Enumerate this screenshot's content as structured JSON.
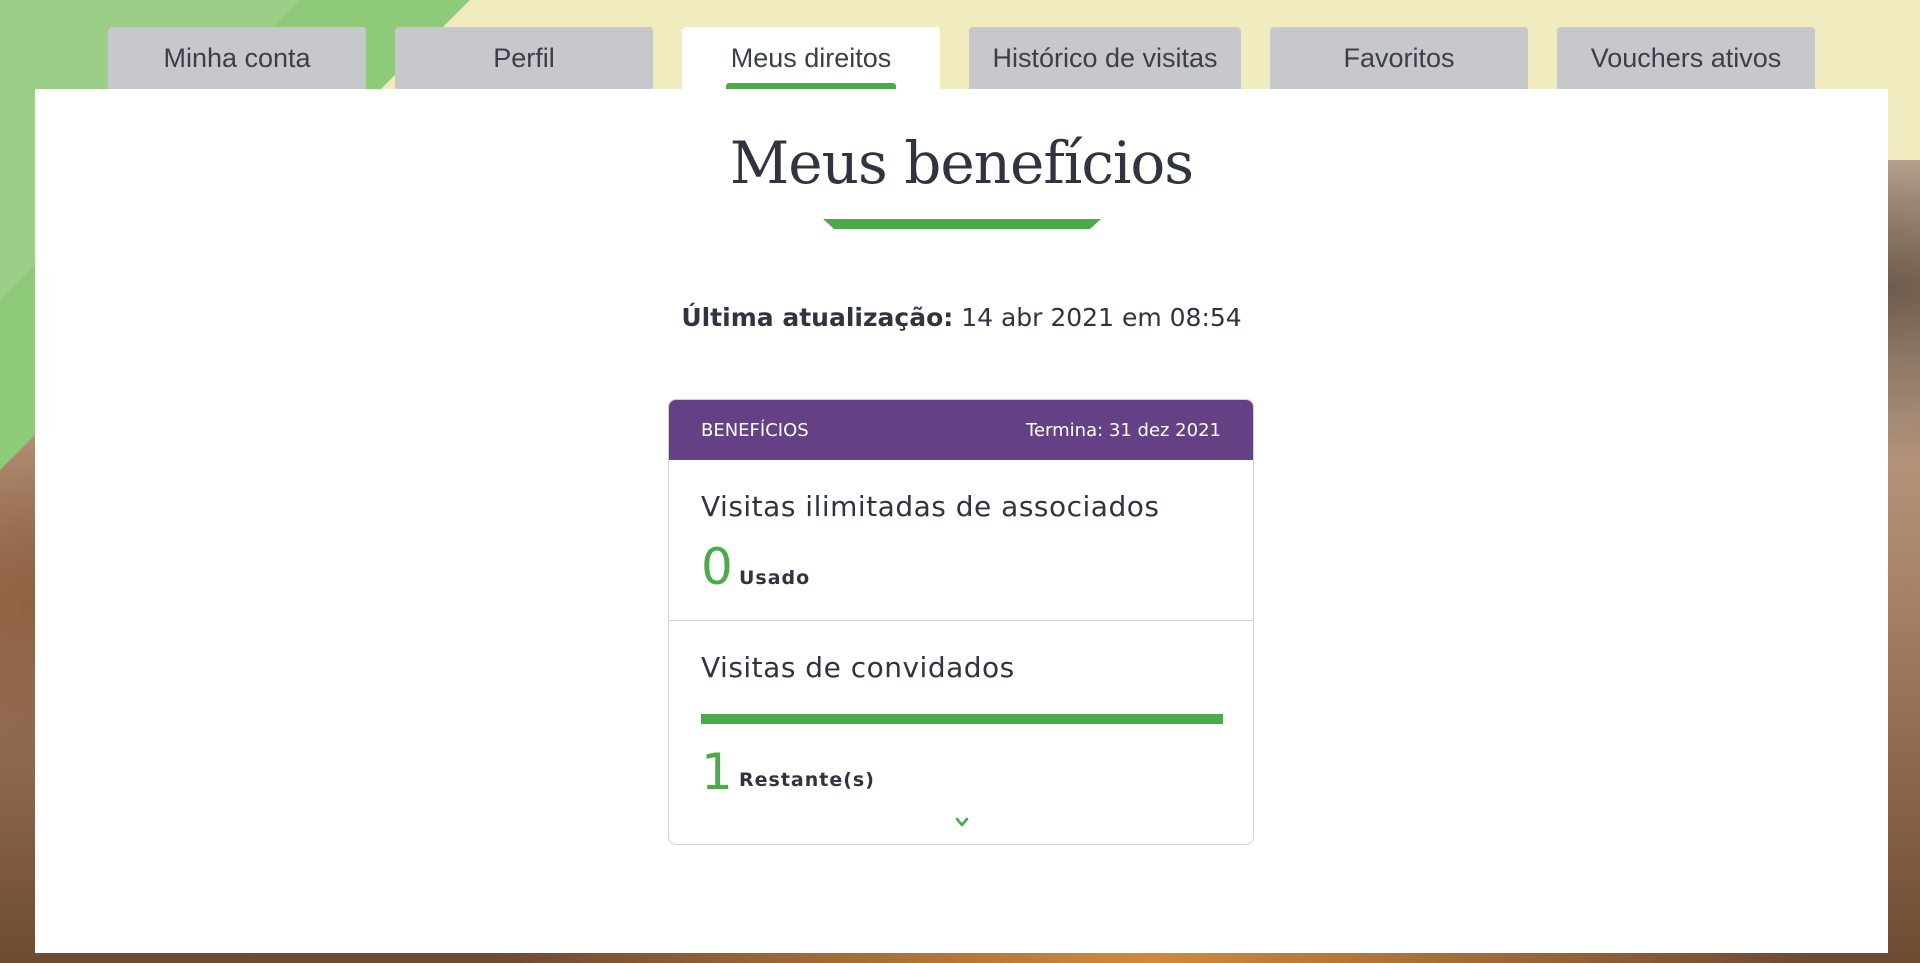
{
  "tabs": [
    {
      "label": "Minha conta"
    },
    {
      "label": "Perfil"
    },
    {
      "label": "Meus direitos",
      "active": true
    },
    {
      "label": "Histórico de visitas"
    },
    {
      "label": "Favoritos"
    },
    {
      "label": "Vouchers ativos"
    }
  ],
  "main": {
    "title": "Meus benefícios",
    "last_update_label": "Última atualização:",
    "last_update_value": "14 abr 2021 em 08:54"
  },
  "card": {
    "header_label": "BENEFÍCIOS",
    "header_end": "Termina: 31 dez 2021",
    "sections": [
      {
        "title": "Visitas ilimitadas de associados",
        "count": "0",
        "count_label": "Usado"
      },
      {
        "title": "Visitas de convidados",
        "count": "1",
        "count_label": "Restante(s)",
        "progress_fraction": 1.0
      }
    ]
  },
  "colors": {
    "accent_green": "#4caa4a",
    "header_purple": "#634184",
    "tab_inactive": "#c7c8cc",
    "text_dark": "#2f3440"
  },
  "icons": {
    "expand": "chevron-down-icon"
  }
}
